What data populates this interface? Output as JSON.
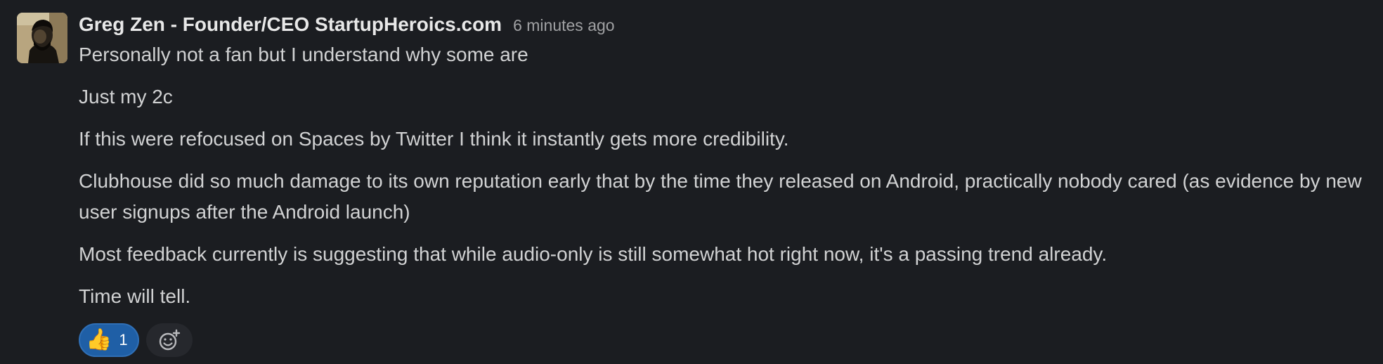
{
  "message": {
    "author": "Greg Zen - Founder/CEO StartupHeroics.com",
    "timestamp": "6 minutes ago",
    "paragraphs": [
      "Personally not a fan but I understand why some are",
      "Just my 2c",
      "If this were refocused on Spaces by Twitter I think it instantly gets more credibility.",
      "Clubhouse did so much damage to its own reputation early that by the time they released on Android, practically nobody cared (as evidence by new user signups  after the Android launch)",
      "Most feedback currently is suggesting that while audio-only is still somewhat hot right now, it's a passing trend already.",
      "Time will tell."
    ],
    "reactions": [
      {
        "emoji": "👍",
        "icon": "thumbs-up-icon",
        "count": "1"
      }
    ],
    "add_reaction_icon": "add-emoji-icon"
  },
  "colors": {
    "background": "#1b1d21",
    "text": "#d1d2d3",
    "timestamp": "#a0a1a3",
    "reaction_bg": "#1f5fa6"
  }
}
